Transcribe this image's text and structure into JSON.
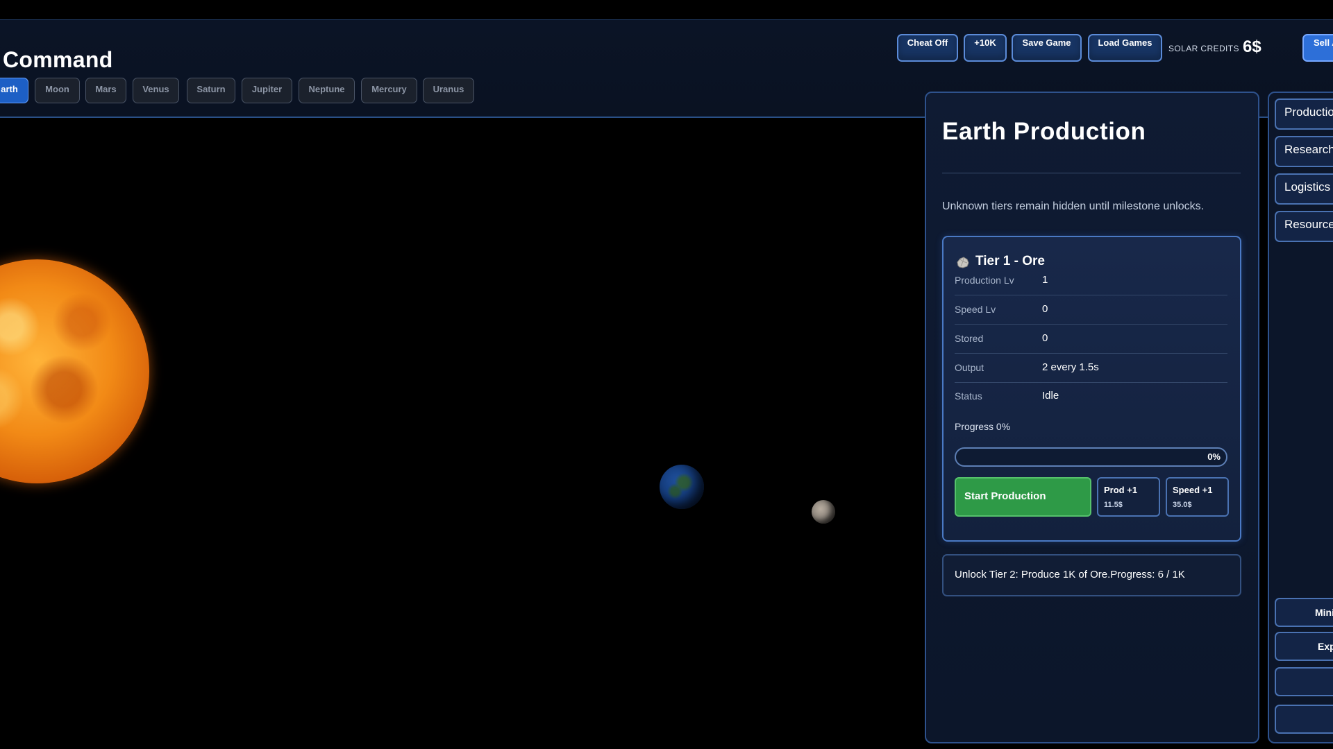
{
  "header": {
    "title": "Command",
    "planets": [
      {
        "label": "arth",
        "active": true
      },
      {
        "label": "Moon",
        "active": false
      },
      {
        "label": "Mars",
        "active": false
      },
      {
        "label": "Venus",
        "active": false
      },
      {
        "label": "Saturn",
        "active": false
      },
      {
        "label": "Jupiter",
        "active": false
      },
      {
        "label": "Neptune",
        "active": false
      },
      {
        "label": "Mercury",
        "active": false
      },
      {
        "label": "Uranus",
        "active": false
      }
    ],
    "buttons": {
      "cheat": "Cheat Off",
      "plus10k": "+10K",
      "save": "Save Game",
      "load": "Load Games",
      "sell": "Sell A"
    },
    "credits_label": "SOLAR CREDITS",
    "credits_value": "6$"
  },
  "production": {
    "title": "Earth Production",
    "note": "Unknown tiers remain hidden until milestone unlocks.",
    "tier": {
      "title": "Tier 1 - Ore",
      "icon": "ore-icon",
      "stats": [
        {
          "label": "Production Lv",
          "value": "1"
        },
        {
          "label": "Speed Lv",
          "value": "0"
        },
        {
          "label": "Stored",
          "value": "0"
        },
        {
          "label": "Output",
          "value": "2 every 1.5s"
        },
        {
          "label": "Status",
          "value": "Idle"
        }
      ],
      "progress_label": "Progress 0%",
      "progress_text": "0%",
      "progress_fraction": 0,
      "start_label": "Start Production",
      "prod_upgrade": {
        "label": "Prod +1",
        "cost": "11.5$"
      },
      "speed_upgrade": {
        "label": "Speed +1",
        "cost": "35.0$"
      }
    },
    "unlock_text": "Unlock Tier 2: Produce 1K of Ore.Progress: 6 / 1K"
  },
  "sidebar": {
    "tabs": [
      "Production",
      "Research",
      "Logistics",
      "Resources"
    ],
    "buttons": [
      "Mini",
      "Exp",
      "<",
      ">"
    ]
  },
  "colors": {
    "accent": "#2d6fd8",
    "start_green": "#2e9a47",
    "panel_border": "#2e528d"
  }
}
